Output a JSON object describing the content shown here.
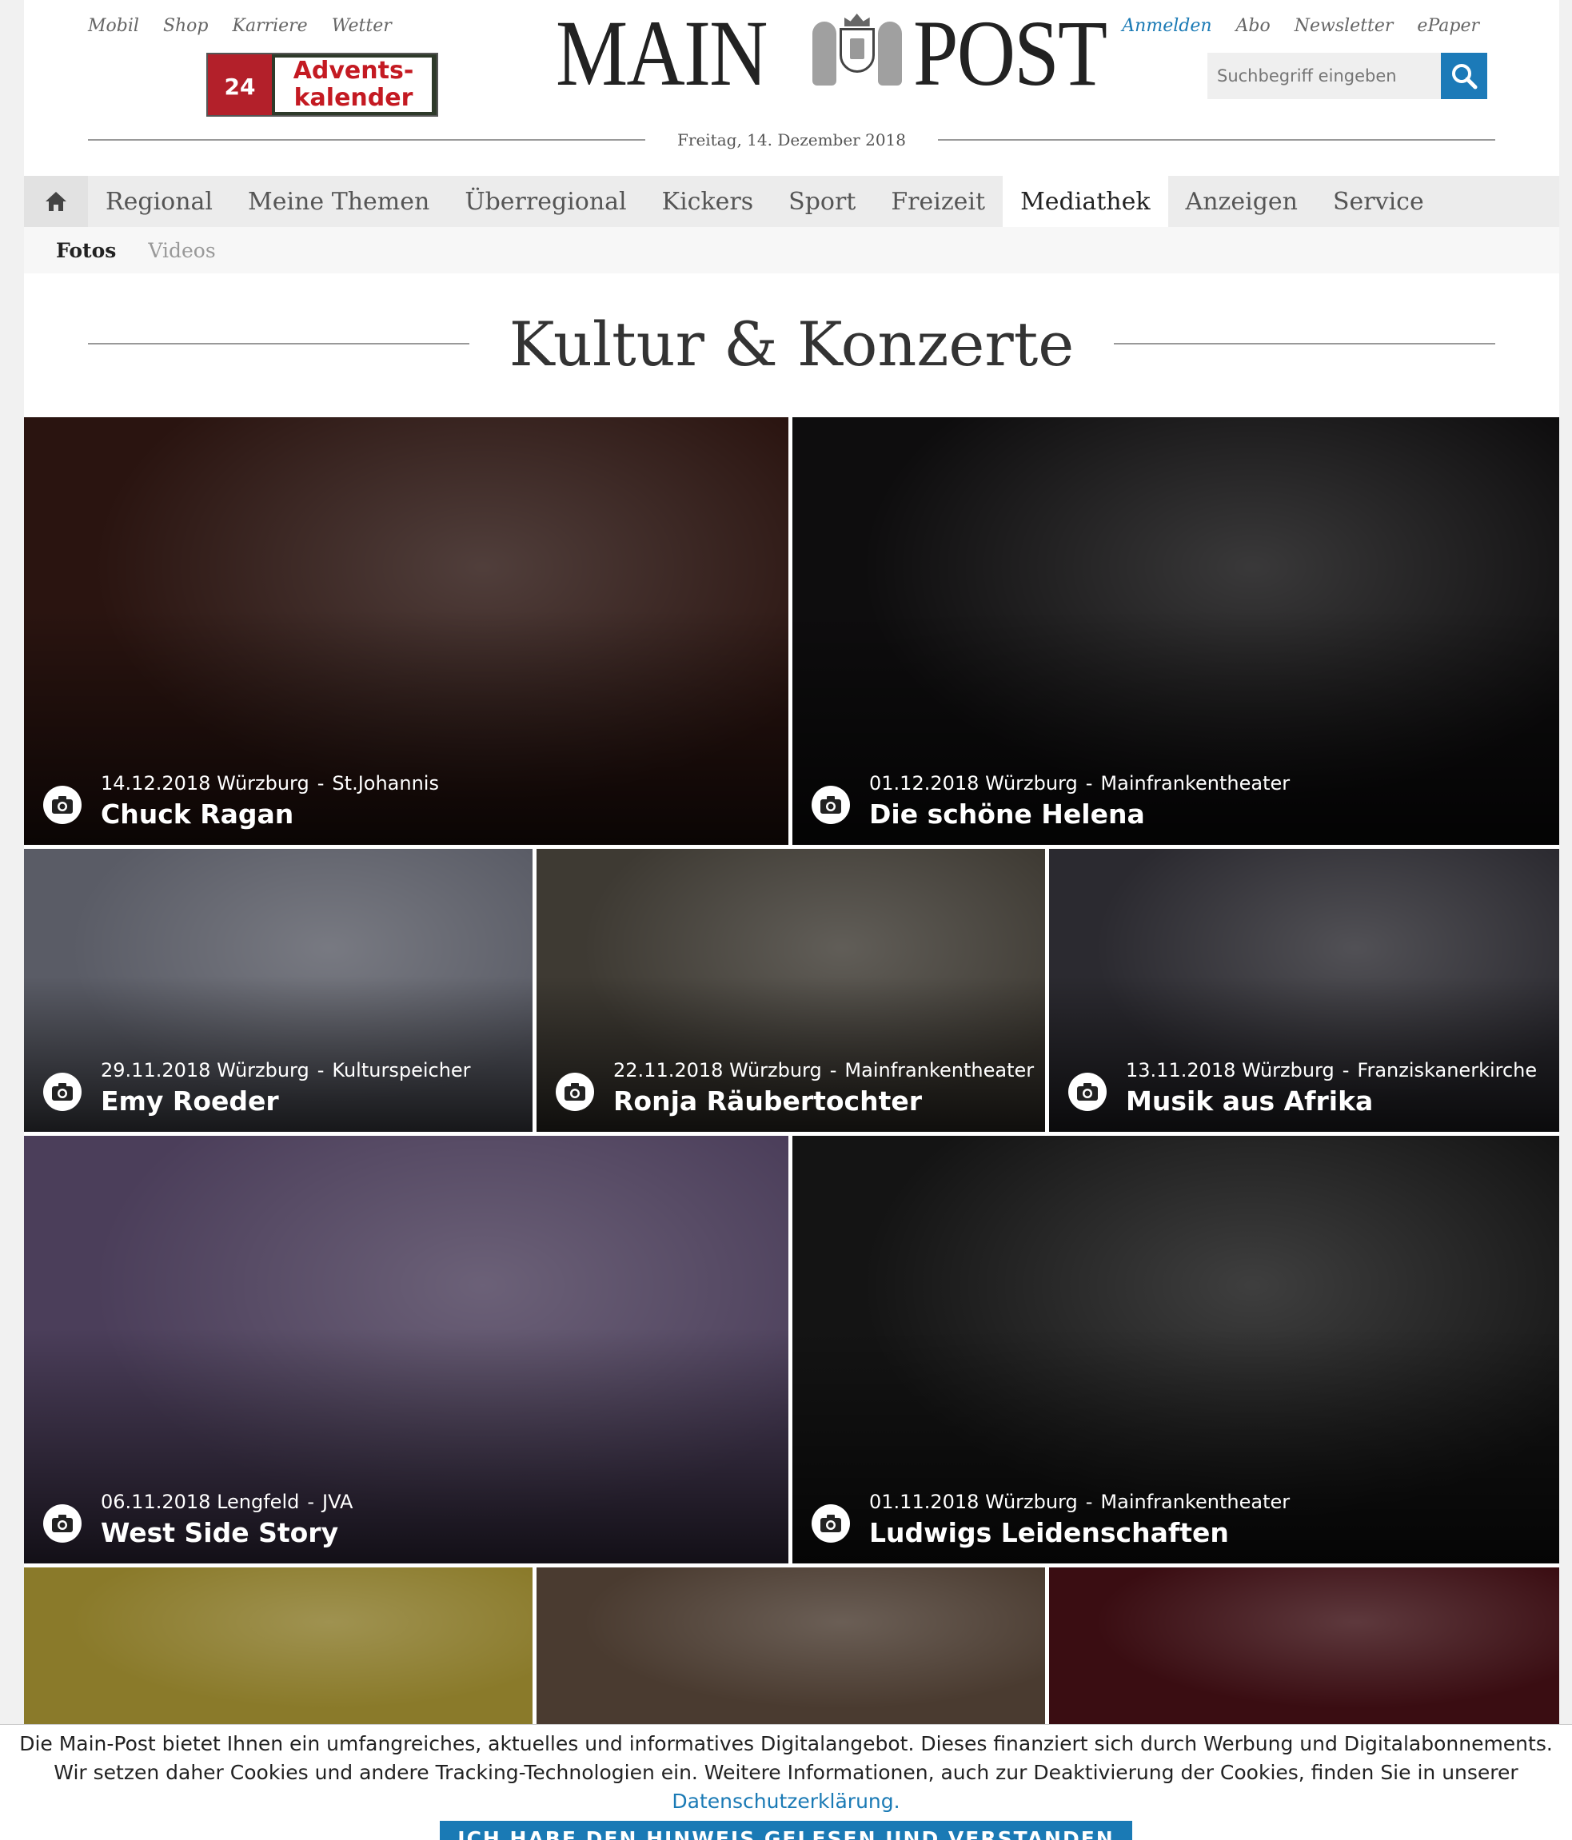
{
  "header": {
    "topnav": [
      "Mobil",
      "Shop",
      "Karriere",
      "Wetter"
    ],
    "advent": {
      "day": "24",
      "line1": "Advents-",
      "line2": "kalender"
    },
    "logo": {
      "left": "MAIN",
      "right": "POST"
    },
    "usernav": [
      "Anmelden",
      "Abo",
      "Newsletter",
      "ePaper"
    ],
    "search": {
      "placeholder": "Suchbegriff eingeben"
    },
    "date": "Freitag, 14. Dezember 2018"
  },
  "mainnav": {
    "items": [
      "Regional",
      "Meine Themen",
      "Überregional",
      "Kickers",
      "Sport",
      "Freizeit",
      "Mediathek",
      "Anzeigen",
      "Service"
    ],
    "active": "Mediathek"
  },
  "subnav": {
    "items": [
      "Fotos",
      "Videos"
    ],
    "active": "Fotos"
  },
  "page_title": "Kultur & Konzerte",
  "gallery": [
    {
      "date": "14.12.2018",
      "place": "Würzburg",
      "venue": "St.Johannis",
      "title": "Chuck Ragan",
      "color": "#2a1410"
    },
    {
      "date": "01.12.2018",
      "place": "Würzburg",
      "venue": "Mainfrankentheater",
      "title": "Die schöne Helena",
      "color": "#0e0d0e"
    },
    {
      "date": "29.11.2018",
      "place": "Würzburg",
      "venue": "Kulturspeicher",
      "title": "Emy Roeder",
      "color": "#5a5c66"
    },
    {
      "date": "22.11.2018",
      "place": "Würzburg",
      "venue": "Mainfrankentheater",
      "title": "Ronja Räubertochter",
      "color": "#3e3a33"
    },
    {
      "date": "13.11.2018",
      "place": "Würzburg",
      "venue": "Franziskanerkirche",
      "title": "Musik aus Afrika",
      "color": "#2b2a30"
    },
    {
      "date": "06.11.2018",
      "place": "Lengfeld",
      "venue": "JVA",
      "title": "West Side Story",
      "color": "#4b3e5a"
    },
    {
      "date": "01.11.2018",
      "place": "Würzburg",
      "venue": "Mainfrankentheater",
      "title": "Ludwigs Leidenschaften",
      "color": "#141414"
    },
    {
      "color": "#8a7a2a"
    },
    {
      "color": "#4a3b30"
    },
    {
      "color": "#3a0d12"
    }
  ],
  "cookie": {
    "text": "Die Main-Post bietet Ihnen ein umfangreiches, aktuelles und informatives Digitalangebot. Dieses finanziert sich durch Werbung und Digitalabonnements. Wir setzen daher Cookies und andere Tracking-Technologien ein. Weitere Informationen, auch zur Deaktivierung der Cookies, finden Sie in unserer",
    "link": "Datenschutzerklärung.",
    "button": "ICH HABE DEN HINWEIS GELESEN UND VERSTANDEN"
  },
  "colors": {
    "accent": "#1a7ab5"
  }
}
